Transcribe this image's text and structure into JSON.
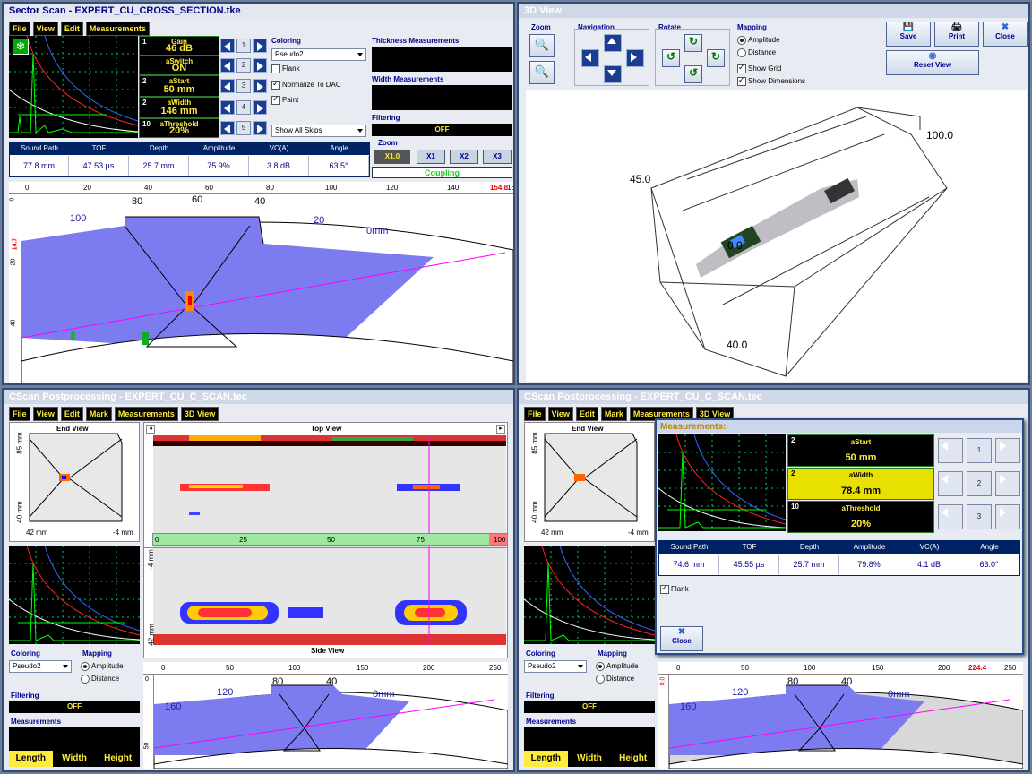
{
  "sector_scan": {
    "title": "Sector Scan - EXPERT_CU_CROSS_SECTION.tke",
    "menu": [
      "File",
      "View",
      "Edit",
      "Measurements"
    ],
    "gates": [
      {
        "num": "1",
        "label": "Gain",
        "value": "46 dB"
      },
      {
        "num": "",
        "label": "aSwitch",
        "value": "ON"
      },
      {
        "num": "2",
        "label": "aStart",
        "value": "50 mm"
      },
      {
        "num": "2",
        "label": "aWidth",
        "value": "146 mm"
      },
      {
        "num": "10",
        "label": "aThreshold",
        "value": "20%"
      }
    ],
    "coloring_label": "Coloring",
    "coloring_value": "Pseudo2",
    "flank": "Flank",
    "normalize": "Normalize To DAC",
    "paint": "Paint",
    "skips": "Show All Skips",
    "thickness_label": "Thickness Measurements",
    "width_label": "Width Measurements",
    "filtering_label": "Filtering",
    "filtering_value": "OFF",
    "zoom_label": "Zoom",
    "zoom": [
      "X1.0",
      "X1",
      "X2",
      "X3"
    ],
    "coupling": "Coupling",
    "readings_headers": [
      "Sound Path",
      "TOF",
      "Depth",
      "Amplitude",
      "VC(A)",
      "Angle"
    ],
    "readings_values": [
      "77.8 mm",
      "47.53 µs",
      "25.7 mm",
      "75.9%",
      "3.8 dB",
      "63.5°"
    ],
    "ruler_ticks": [
      "0",
      "20",
      "40",
      "60",
      "80",
      "100",
      "120",
      "140"
    ],
    "ruler_cursor": "154.8",
    "ruler_end": "16",
    "vruler": [
      "0",
      "20",
      "14.7",
      "40"
    ],
    "arc_labels": [
      "100",
      "80",
      "60",
      "40",
      "20",
      "0mm"
    ]
  },
  "view3d": {
    "title": "3D View",
    "zoom_label": "Zoom",
    "navigation_label": "Navigation",
    "rotate_label": "Rotate",
    "mapping_label": "Mapping",
    "amplitude": "Amplitude",
    "distance": "Distance",
    "show_grid": "Show Grid",
    "show_dimensions": "Show Dimensions",
    "save": "Save",
    "print": "Print",
    "close": "Close",
    "reset_view": "Reset View",
    "dims": [
      "100.0",
      "45.0",
      "0.0",
      "40.0"
    ]
  },
  "cscan_left": {
    "title": "CScan Postprocessing - EXPERT_CU_C_SCAN.tec",
    "menu": [
      "File",
      "View",
      "Edit",
      "Mark",
      "Measurements",
      "3D View"
    ],
    "end_view": "End View",
    "top_view": "Top View",
    "side_view": "Side View",
    "end_axis": [
      "85 mm",
      "40 mm",
      "42 mm",
      "-4 mm"
    ],
    "top_axis": [
      "0",
      "25",
      "50",
      "75",
      "100"
    ],
    "side_axis": [
      "-4 mm",
      "42 mm"
    ],
    "bottom_ruler": [
      "0",
      "50",
      "100",
      "150",
      "200",
      "250"
    ],
    "bottom_vruler": [
      "0",
      "50"
    ],
    "arc_labels": [
      "160",
      "120",
      "80",
      "40",
      "0mm"
    ],
    "coloring_label": "Coloring",
    "coloring_value": "Pseudo2",
    "mapping_label": "Mapping",
    "amplitude": "Amplitude",
    "distance": "Distance",
    "filtering_label": "Filtering",
    "filtering_value": "OFF",
    "measurements_label": "Measurements",
    "tabs": [
      "Length",
      "Width",
      "Height"
    ]
  },
  "cscan_right": {
    "title": "CScan Postprocessing - EXPERT_CU_C_SCAN.tec",
    "menu": [
      "File",
      "View",
      "Edit",
      "Mark",
      "Measurements",
      "3D View"
    ],
    "end_view": "End View",
    "end_axis": [
      "85 mm",
      "40 mm",
      "42 mm",
      "-4 mm"
    ],
    "coloring_label": "Coloring",
    "coloring_value": "Pseudo2",
    "mapping_label": "Mapping",
    "amplitude": "Amplitude",
    "distance": "Distance",
    "filtering_label": "Filtering",
    "filtering_value": "OFF",
    "measurements_label": "Measurements",
    "tabs": [
      "Length",
      "Width",
      "Height"
    ],
    "bottom_ruler": [
      "0",
      "50",
      "100",
      "150",
      "200",
      "250"
    ],
    "ruler_cursor": "224.4",
    "bottom_vruler": [
      "0.0"
    ],
    "arc_labels": [
      "160",
      "120",
      "80",
      "40",
      "0mm"
    ]
  },
  "measure_dialog": {
    "title": "Measurements:",
    "gates": [
      {
        "num": "2",
        "label": "aStart",
        "value": "50 mm"
      },
      {
        "num": "2",
        "label": "aWidth",
        "value": "78.4 mm"
      },
      {
        "num": "10",
        "label": "aThreshold",
        "value": "20%"
      }
    ],
    "readings_headers": [
      "Sound Path",
      "TOF",
      "Depth",
      "Amplitude",
      "VC(A)",
      "Angle"
    ],
    "readings_values": [
      "74.6 mm",
      "45.55 µs",
      "25.7 mm",
      "79.8%",
      "4.1 dB",
      "63.0°"
    ],
    "flank": "Flank",
    "close": "Close"
  }
}
